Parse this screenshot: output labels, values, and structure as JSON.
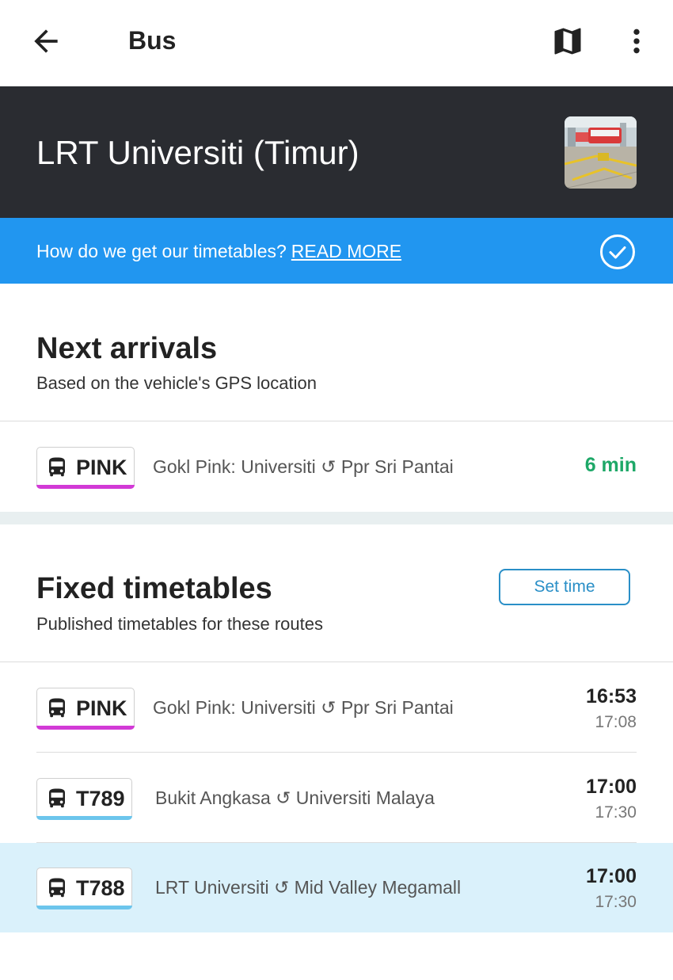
{
  "app_bar": {
    "title": "Bus",
    "back_icon": "arrow-left-icon",
    "map_icon": "map-icon",
    "more_icon": "more-vert-icon"
  },
  "stop": {
    "name": "LRT Universiti (Timur)",
    "photo": "stop-photo"
  },
  "info_banner": {
    "text": "How do we get our timetables?",
    "link": "READ MORE",
    "icon": "check-circle-icon"
  },
  "next_arrivals": {
    "title": "Next arrivals",
    "subtitle": "Based on the vehicle's GPS location",
    "rows": [
      {
        "route": "PINK",
        "color": "#d23ad6",
        "description": "Gokl Pink: Universiti ↺ Ppr Sri Pantai",
        "eta": "6 min"
      }
    ]
  },
  "fixed_timetables": {
    "title": "Fixed timetables",
    "subtitle": "Published timetables for these routes",
    "set_time_label": "Set time",
    "rows": [
      {
        "route": "PINK",
        "color": "#d23ad6",
        "description": "Gokl Pink: Universiti ↺ Ppr Sri Pantai",
        "time1": "16:53",
        "time2": "17:08"
      },
      {
        "route": "T789",
        "color": "#6cc5ec",
        "description": "Bukit Angkasa ↺ Universiti Malaya",
        "time1": "17:00",
        "time2": "17:30"
      },
      {
        "route": "T788",
        "color": "#6cc5ec",
        "description": "LRT Universiti ↺ Mid Valley Megamall",
        "time1": "17:00",
        "time2": "17:30"
      }
    ]
  },
  "colors": {
    "header_bg": "#2a2c31",
    "banner_bg": "#2196f0",
    "eta_green": "#1ea868",
    "accent_blue": "#2a8fc7",
    "highlight_row": "#daf1fb"
  }
}
